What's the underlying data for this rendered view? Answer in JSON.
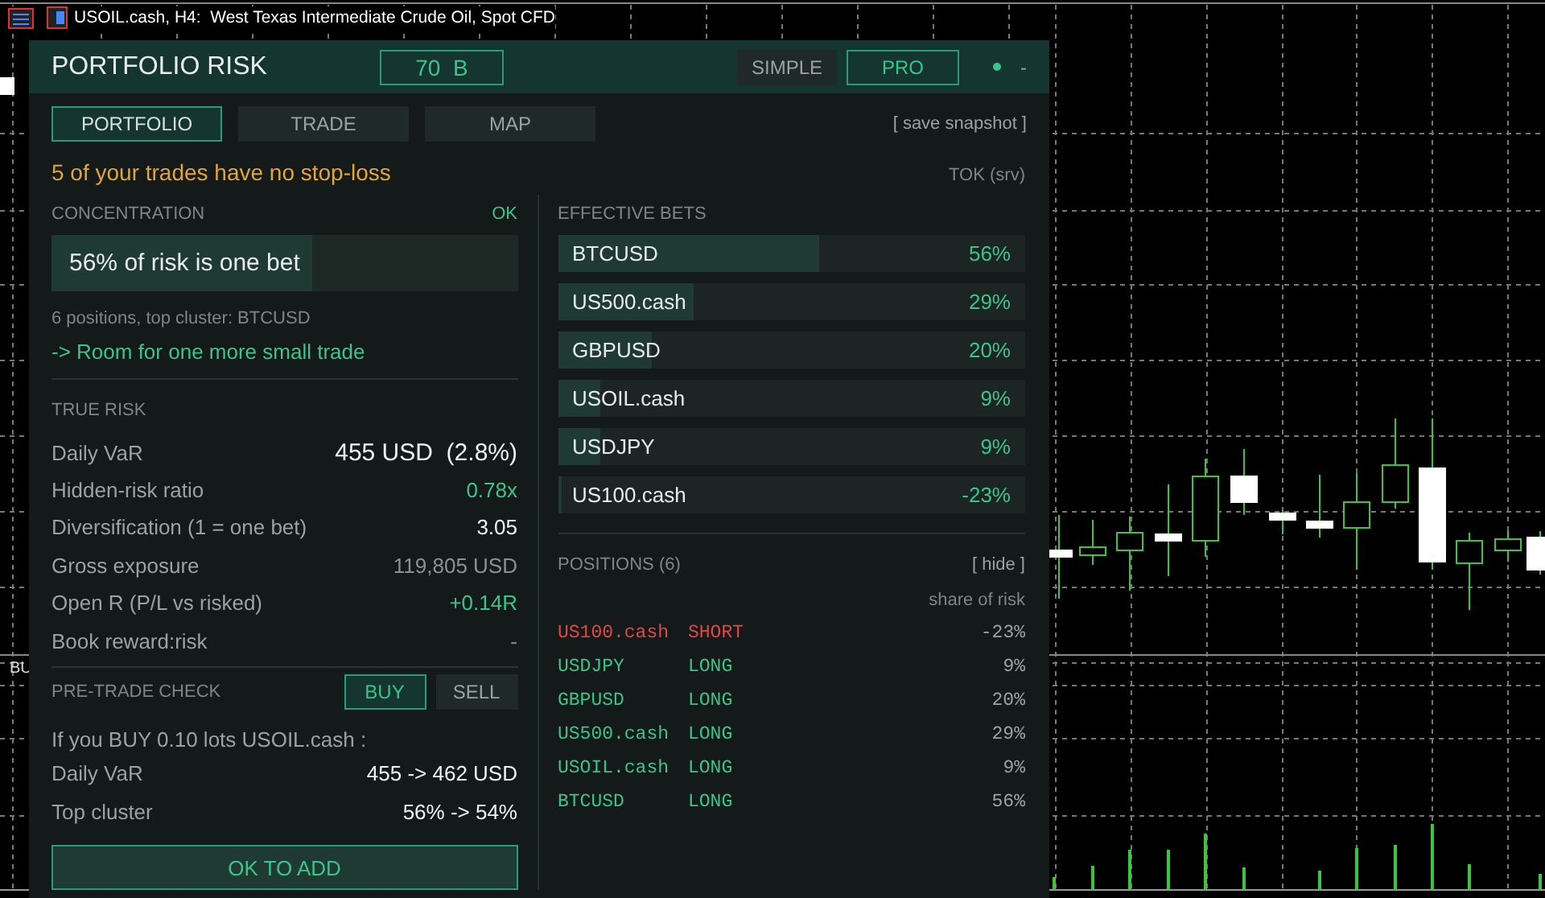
{
  "chart": {
    "title": "USOIL.cash, H4:  West Texas Intermediate Crude Oil, Spot CFD",
    "indicator_label": "BU"
  },
  "panel": {
    "title": "PORTFOLIO RISK",
    "score": "70  B",
    "modes": [
      {
        "label": "SIMPLE",
        "selected": false
      },
      {
        "label": "PRO",
        "selected": true
      }
    ],
    "minimize": "-",
    "tabs": [
      {
        "label": "PORTFOLIO",
        "selected": true
      },
      {
        "label": "TRADE",
        "selected": false
      },
      {
        "label": "MAP",
        "selected": false
      }
    ],
    "save_snapshot": "[ save snapshot ]",
    "warning": "5 of your trades have no stop-loss",
    "session": "TOK (srv)"
  },
  "concentration": {
    "heading": "CONCENTRATION",
    "status": "OK",
    "headline": "56% of risk is one bet",
    "level": 0.56,
    "detail": "6 positions, top cluster: BTCUSD",
    "advice": "-> Room for one more small trade"
  },
  "true_risk": {
    "heading": "TRUE RISK",
    "rows": [
      {
        "label": "Daily VaR",
        "value": "455 USD  (2.8%)",
        "kind": "strong"
      },
      {
        "label": "Hidden-risk ratio",
        "value": "0.78x",
        "kind": "positive"
      },
      {
        "label": "Diversification (1 = one bet)",
        "value": "3.05",
        "kind": "neutral"
      },
      {
        "label": "Gross exposure",
        "value": "119,805 USD",
        "kind": "muted"
      },
      {
        "label": "Open R (P/L vs risked)",
        "value": "+0.14R",
        "kind": "positive"
      },
      {
        "label": "Book reward:risk",
        "value": "-",
        "kind": "muted"
      }
    ]
  },
  "pre_trade": {
    "heading": "PRE-TRADE CHECK",
    "sides": [
      {
        "label": "BUY",
        "selected": true
      },
      {
        "label": "SELL",
        "selected": false
      }
    ],
    "summary": "If you BUY 0.10 lots USOIL.cash :",
    "rows": [
      {
        "label": "Daily VaR",
        "value": "455 -> 462 USD"
      },
      {
        "label": "Top cluster",
        "value": "56% -> 54%"
      }
    ],
    "verdict": "OK TO ADD"
  },
  "effective_bets": {
    "heading": "EFFECTIVE BETS",
    "items": [
      {
        "symbol": "BTCUSD",
        "share": "56%",
        "level": 0.56
      },
      {
        "symbol": "US500.cash",
        "share": "29%",
        "level": 0.29
      },
      {
        "symbol": "GBPUSD",
        "share": "20%",
        "level": 0.2
      },
      {
        "symbol": "USOIL.cash",
        "share": "9%",
        "level": 0.09
      },
      {
        "symbol": "USDJPY",
        "share": "9%",
        "level": 0.09
      },
      {
        "symbol": "US100.cash",
        "share": "-23%",
        "level": 0.01
      }
    ]
  },
  "positions": {
    "heading": "POSITIONS (6)",
    "hide": "[ hide ]",
    "column_heading": "share of risk",
    "rows": [
      {
        "symbol": "US100.cash",
        "side": "SHORT",
        "share": "-23%",
        "kind": "short"
      },
      {
        "symbol": "USDJPY",
        "side": "LONG",
        "share": "9%",
        "kind": "long"
      },
      {
        "symbol": "GBPUSD",
        "side": "LONG",
        "share": "20%",
        "kind": "long"
      },
      {
        "symbol": "US500.cash",
        "side": "LONG",
        "share": "29%",
        "kind": "long"
      },
      {
        "symbol": "USOIL.cash",
        "side": "LONG",
        "share": "9%",
        "kind": "long"
      },
      {
        "symbol": "BTCUSD",
        "side": "LONG",
        "share": "56%",
        "kind": "long"
      }
    ]
  }
}
